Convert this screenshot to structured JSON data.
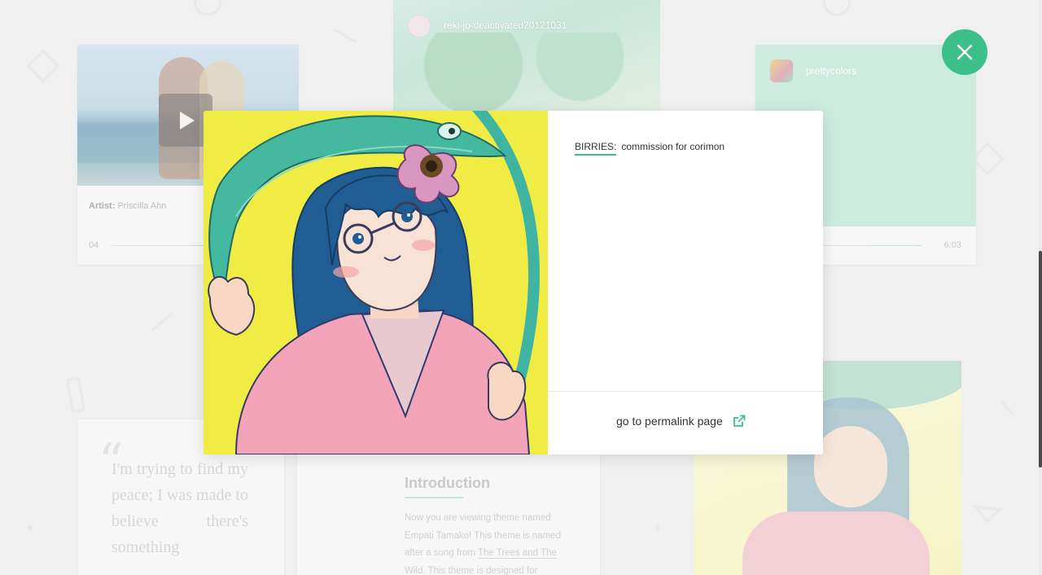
{
  "background": {
    "music_card": {
      "artist_label": "Artist:",
      "artist_name": "Priscilla Ahn",
      "track_number": "04"
    },
    "photo_card": {
      "username": "reki-jo-deactivated20121031"
    },
    "green_card": {
      "username": "prettycolors",
      "duration": "6:03"
    },
    "quote_card": {
      "text": "I'm trying to find my peace; I was made to believe there's something"
    },
    "intro_card": {
      "title": "Introduction",
      "body_1": "Now you are viewing theme named Empati Tamako! This theme is named after a song from ",
      "link": "The Trees and The Wild",
      "body_2": ". This theme is designed for"
    }
  },
  "modal": {
    "caption_user": "BIRRIES:",
    "caption_text": "commission for corimon",
    "permalink_label": "go to permalink page"
  },
  "colors": {
    "accent": "#3dbf8a",
    "modal_image_bg": "#f1ec43"
  },
  "icons": {
    "close": "close-icon",
    "external": "external-link-icon",
    "play": "play-icon"
  }
}
